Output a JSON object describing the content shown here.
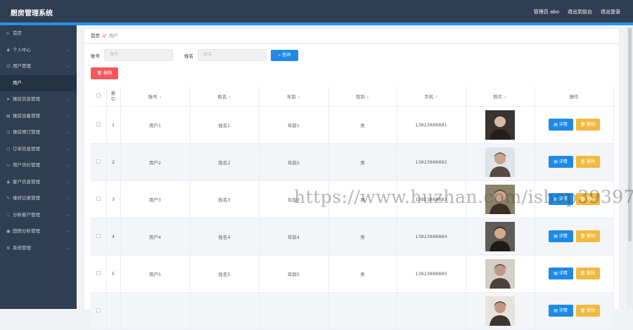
{
  "header": {
    "title": "厨房管理系统",
    "admin_label": "管理员 abo",
    "back_home": "退出到前台",
    "logout": "退出登录"
  },
  "sidebar": {
    "items": [
      {
        "icon": "home-icon",
        "glyph": "⌂",
        "label": "首页",
        "has_chevron": false
      },
      {
        "icon": "user-icon",
        "glyph": "♟",
        "label": "个人中心",
        "has_chevron": true
      },
      {
        "icon": "user-manage-icon",
        "glyph": "☺",
        "label": "用户管理",
        "has_chevron": true
      },
      {
        "icon": "",
        "glyph": "",
        "label": "用户",
        "has_chevron": false,
        "sub": true
      },
      {
        "icon": "send-icon",
        "glyph": "➤",
        "label": "操房信息管理",
        "has_chevron": true
      },
      {
        "icon": "folder-icon",
        "glyph": "▤",
        "label": "操房设备管理",
        "has_chevron": true
      },
      {
        "icon": "clock-icon",
        "glyph": "◷",
        "label": "操房预订管理",
        "has_chevron": true
      },
      {
        "icon": "document-icon",
        "glyph": "▢",
        "label": "订单信息管理",
        "has_chevron": true
      },
      {
        "icon": "chat-icon",
        "glyph": "▭",
        "label": "用户评价管理",
        "has_chevron": true
      },
      {
        "icon": "customer-icon",
        "glyph": "♟",
        "label": "客户信息管理",
        "has_chevron": true
      },
      {
        "icon": "wrench-icon",
        "glyph": "✎",
        "label": "维修记录管理",
        "has_chevron": true
      },
      {
        "icon": "fullscreen-icon",
        "glyph": "⛶",
        "label": "分析客户管理",
        "has_chevron": true
      },
      {
        "icon": "image-icon",
        "glyph": "▣",
        "label": "固债分析管理",
        "has_chevron": true
      },
      {
        "icon": "settings-icon",
        "glyph": "⚙",
        "label": "系统管理",
        "has_chevron": true
      }
    ]
  },
  "breadcrumb": {
    "home": "首页",
    "sep": "//",
    "current": "用户"
  },
  "search": {
    "account_label": "账号",
    "account_placeholder": "账号",
    "name_label": "姓名",
    "name_placeholder": "姓名",
    "query_label": "查询",
    "query_icon": "⌕"
  },
  "actions": {
    "delete_label": "删除",
    "delete_icon": "🗑"
  },
  "table": {
    "headers": {
      "index": "索引",
      "account": "账号",
      "name": "姓名",
      "age": "年龄",
      "gender": "性别",
      "phone": "手机",
      "photo": "照片",
      "ops": "操作"
    },
    "sort_glyph": "⇕",
    "rows": [
      {
        "index": "1",
        "account": "用户1",
        "name": "姓名1",
        "age": "年龄1",
        "gender": "男",
        "phone": "13823888881"
      },
      {
        "index": "2",
        "account": "用户2",
        "name": "姓名2",
        "age": "年龄2",
        "gender": "男",
        "phone": "13823888882"
      },
      {
        "index": "3",
        "account": "用户3",
        "name": "姓名3",
        "age": "年龄3",
        "gender": "男",
        "phone": "13823888883"
      },
      {
        "index": "4",
        "account": "用户4",
        "name": "姓名4",
        "age": "年龄4",
        "gender": "男",
        "phone": "13823888884"
      },
      {
        "index": "5",
        "account": "用户5",
        "name": "姓名5",
        "age": "年龄5",
        "gender": "男",
        "phone": "13823888885"
      },
      {
        "index": "",
        "account": "",
        "name": "",
        "age": "",
        "gender": "",
        "phone": ""
      }
    ],
    "detail_label": "详情",
    "detail_icon": "▤",
    "remove_label": "删除",
    "remove_icon": "🗑"
  },
  "watermark": "https://www.huzhan.com/ishop39397",
  "colors": {
    "header_bg": "#2f3e52",
    "accent": "#2490e8",
    "primary_button": "#1e8ae6",
    "danger_button": "#f5575c",
    "warning_button": "#f3b93f"
  }
}
